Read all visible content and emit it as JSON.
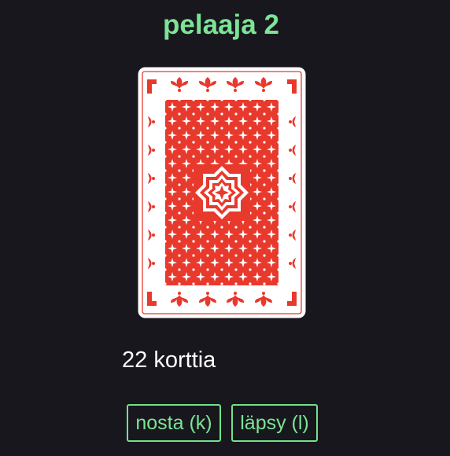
{
  "player": {
    "title": "pelaaja 2"
  },
  "card": {
    "state": "face-down",
    "back_color": "#e8392d",
    "face_color": "#ffffff"
  },
  "deck": {
    "count_label": "22 korttia"
  },
  "actions": {
    "draw_label": "nosta (k)",
    "slap_label": "läpsy (l)"
  },
  "colors": {
    "background": "#18171d",
    "accent": "#7be495",
    "text": "#ffffff"
  }
}
